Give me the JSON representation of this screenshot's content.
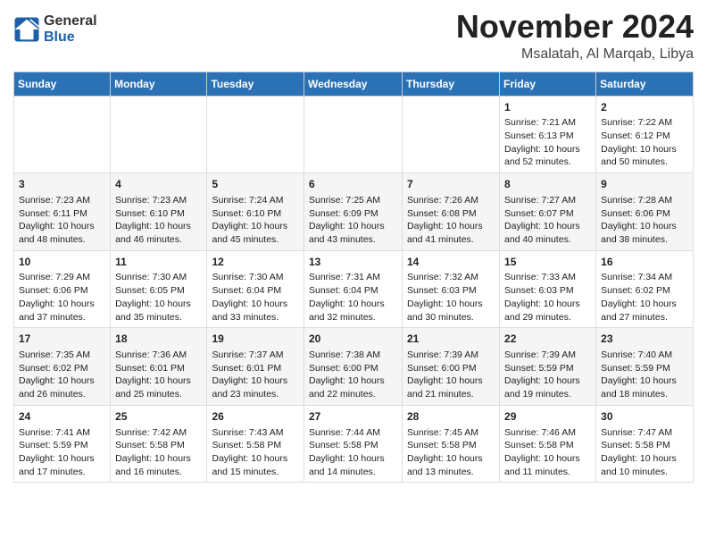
{
  "header": {
    "logo_general": "General",
    "logo_blue": "Blue",
    "month": "November 2024",
    "location": "Msalatah, Al Marqab, Libya"
  },
  "days_of_week": [
    "Sunday",
    "Monday",
    "Tuesday",
    "Wednesday",
    "Thursday",
    "Friday",
    "Saturday"
  ],
  "weeks": [
    [
      {
        "day": "",
        "info": ""
      },
      {
        "day": "",
        "info": ""
      },
      {
        "day": "",
        "info": ""
      },
      {
        "day": "",
        "info": ""
      },
      {
        "day": "",
        "info": ""
      },
      {
        "day": "1",
        "info": "Sunrise: 7:21 AM\nSunset: 6:13 PM\nDaylight: 10 hours and 52 minutes."
      },
      {
        "day": "2",
        "info": "Sunrise: 7:22 AM\nSunset: 6:12 PM\nDaylight: 10 hours and 50 minutes."
      }
    ],
    [
      {
        "day": "3",
        "info": "Sunrise: 7:23 AM\nSunset: 6:11 PM\nDaylight: 10 hours and 48 minutes."
      },
      {
        "day": "4",
        "info": "Sunrise: 7:23 AM\nSunset: 6:10 PM\nDaylight: 10 hours and 46 minutes."
      },
      {
        "day": "5",
        "info": "Sunrise: 7:24 AM\nSunset: 6:10 PM\nDaylight: 10 hours and 45 minutes."
      },
      {
        "day": "6",
        "info": "Sunrise: 7:25 AM\nSunset: 6:09 PM\nDaylight: 10 hours and 43 minutes."
      },
      {
        "day": "7",
        "info": "Sunrise: 7:26 AM\nSunset: 6:08 PM\nDaylight: 10 hours and 41 minutes."
      },
      {
        "day": "8",
        "info": "Sunrise: 7:27 AM\nSunset: 6:07 PM\nDaylight: 10 hours and 40 minutes."
      },
      {
        "day": "9",
        "info": "Sunrise: 7:28 AM\nSunset: 6:06 PM\nDaylight: 10 hours and 38 minutes."
      }
    ],
    [
      {
        "day": "10",
        "info": "Sunrise: 7:29 AM\nSunset: 6:06 PM\nDaylight: 10 hours and 37 minutes."
      },
      {
        "day": "11",
        "info": "Sunrise: 7:30 AM\nSunset: 6:05 PM\nDaylight: 10 hours and 35 minutes."
      },
      {
        "day": "12",
        "info": "Sunrise: 7:30 AM\nSunset: 6:04 PM\nDaylight: 10 hours and 33 minutes."
      },
      {
        "day": "13",
        "info": "Sunrise: 7:31 AM\nSunset: 6:04 PM\nDaylight: 10 hours and 32 minutes."
      },
      {
        "day": "14",
        "info": "Sunrise: 7:32 AM\nSunset: 6:03 PM\nDaylight: 10 hours and 30 minutes."
      },
      {
        "day": "15",
        "info": "Sunrise: 7:33 AM\nSunset: 6:03 PM\nDaylight: 10 hours and 29 minutes."
      },
      {
        "day": "16",
        "info": "Sunrise: 7:34 AM\nSunset: 6:02 PM\nDaylight: 10 hours and 27 minutes."
      }
    ],
    [
      {
        "day": "17",
        "info": "Sunrise: 7:35 AM\nSunset: 6:02 PM\nDaylight: 10 hours and 26 minutes."
      },
      {
        "day": "18",
        "info": "Sunrise: 7:36 AM\nSunset: 6:01 PM\nDaylight: 10 hours and 25 minutes."
      },
      {
        "day": "19",
        "info": "Sunrise: 7:37 AM\nSunset: 6:01 PM\nDaylight: 10 hours and 23 minutes."
      },
      {
        "day": "20",
        "info": "Sunrise: 7:38 AM\nSunset: 6:00 PM\nDaylight: 10 hours and 22 minutes."
      },
      {
        "day": "21",
        "info": "Sunrise: 7:39 AM\nSunset: 6:00 PM\nDaylight: 10 hours and 21 minutes."
      },
      {
        "day": "22",
        "info": "Sunrise: 7:39 AM\nSunset: 5:59 PM\nDaylight: 10 hours and 19 minutes."
      },
      {
        "day": "23",
        "info": "Sunrise: 7:40 AM\nSunset: 5:59 PM\nDaylight: 10 hours and 18 minutes."
      }
    ],
    [
      {
        "day": "24",
        "info": "Sunrise: 7:41 AM\nSunset: 5:59 PM\nDaylight: 10 hours and 17 minutes."
      },
      {
        "day": "25",
        "info": "Sunrise: 7:42 AM\nSunset: 5:58 PM\nDaylight: 10 hours and 16 minutes."
      },
      {
        "day": "26",
        "info": "Sunrise: 7:43 AM\nSunset: 5:58 PM\nDaylight: 10 hours and 15 minutes."
      },
      {
        "day": "27",
        "info": "Sunrise: 7:44 AM\nSunset: 5:58 PM\nDaylight: 10 hours and 14 minutes."
      },
      {
        "day": "28",
        "info": "Sunrise: 7:45 AM\nSunset: 5:58 PM\nDaylight: 10 hours and 13 minutes."
      },
      {
        "day": "29",
        "info": "Sunrise: 7:46 AM\nSunset: 5:58 PM\nDaylight: 10 hours and 11 minutes."
      },
      {
        "day": "30",
        "info": "Sunrise: 7:47 AM\nSunset: 5:58 PM\nDaylight: 10 hours and 10 minutes."
      }
    ]
  ]
}
